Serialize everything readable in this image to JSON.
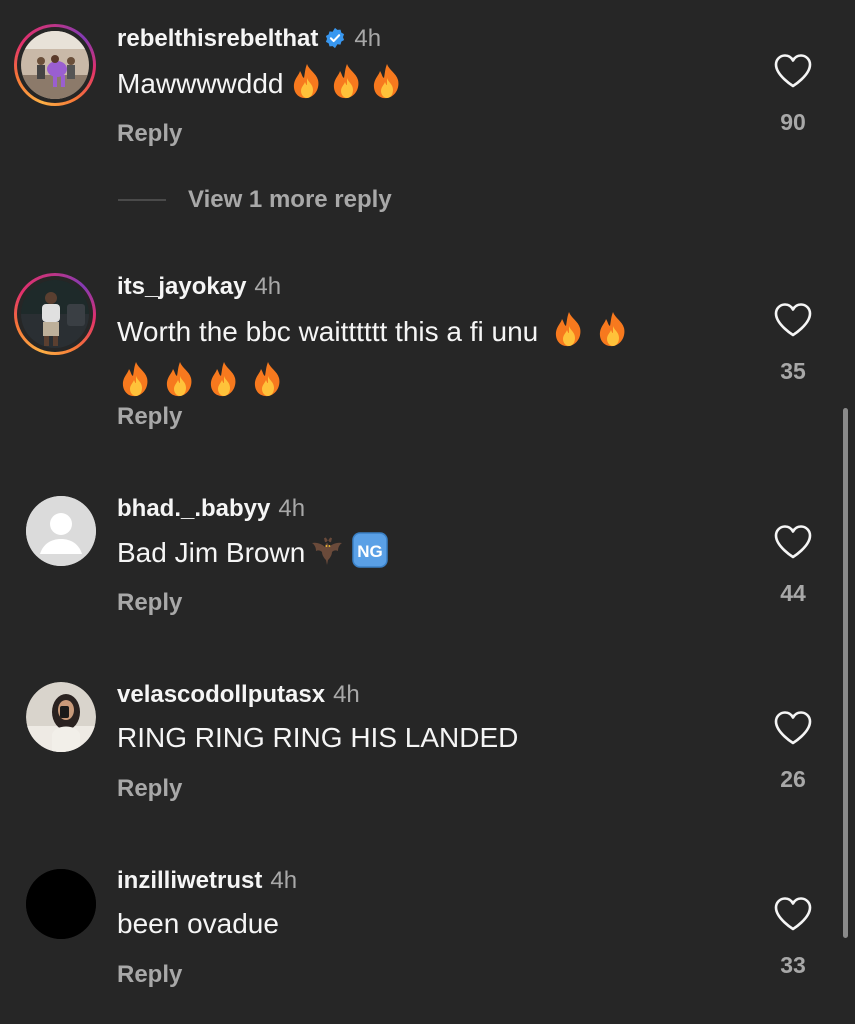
{
  "comments": [
    {
      "username": "rebelthisrebelthat",
      "verified": true,
      "time": "4h",
      "text": "Mawwwwddd",
      "emojis": [
        "fire",
        "fire",
        "fire"
      ],
      "reply_label": "Reply",
      "likes": "90",
      "view_more": "View 1 more reply"
    },
    {
      "username": "its_jayokay",
      "time": "4h",
      "text": "Worth the bbc waitttttt this a fi unu",
      "emojis_line1": [
        "fire",
        "fire"
      ],
      "emojis_line2": [
        "fire",
        "fire",
        "fire",
        "fire"
      ],
      "reply_label": "Reply",
      "likes": "35"
    },
    {
      "username": "bhad._.babyy",
      "time": "4h",
      "text": "Bad Jim Brown",
      "emojis": [
        "bat",
        "ng-button"
      ],
      "reply_label": "Reply",
      "likes": "44"
    },
    {
      "username": "velascodollputasx",
      "time": "4h",
      "text": "RING RING RING HIS LANDED",
      "reply_label": "Reply",
      "likes": "26"
    },
    {
      "username": "inzilliwetrust",
      "time": "4h",
      "text": "been ovadue",
      "reply_label": "Reply",
      "likes": "33"
    }
  ],
  "colors": {
    "background": "#262626",
    "primary_text": "#f5f5f5",
    "secondary_text": "#a8a8a8",
    "verified_blue": "#3897f0",
    "fire_orange": "#f7791e"
  }
}
